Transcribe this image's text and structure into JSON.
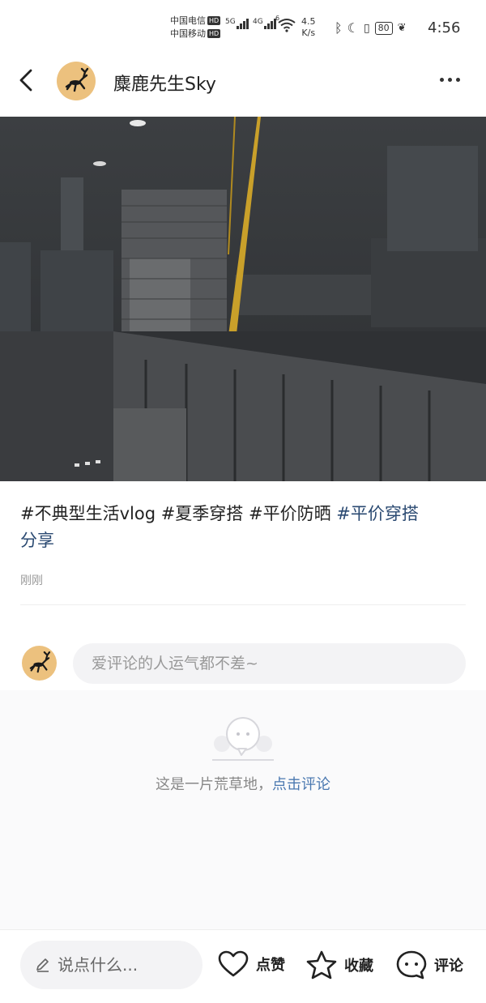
{
  "status_bar": {
    "carrier1": "中国电信",
    "carrier2": "中国移动",
    "hd": "HD",
    "net1": "5G",
    "net2": "4G",
    "wifi_sub": "6",
    "speed_value": "4.5",
    "speed_unit": "K/s",
    "battery": "80",
    "time": "4:56"
  },
  "header": {
    "username": "麋鹿先生Sky"
  },
  "post": {
    "tags_plain": "#不典型生活vlog #夏季穿搭 #平价防晒",
    "tag_link_part1": "#平价穿搭",
    "tag_link_part2": "分享",
    "time_ago": "刚刚"
  },
  "comment": {
    "placeholder": "爱评论的人运气都不差~",
    "empty_text": "这是一片荒草地，",
    "empty_link": "点击评论"
  },
  "bottom_bar": {
    "say_placeholder": "说点什么...",
    "like_label": "点赞",
    "collect_label": "收藏",
    "comment_label": "评论"
  },
  "icons": {
    "back": "chevron-left-icon",
    "more": "more-dots-icon",
    "edit": "pencil-icon",
    "like": "heart-icon",
    "collect": "star-icon",
    "comment": "speech-bubble-icon",
    "empty": "empty-chat-icon"
  },
  "colors": {
    "avatar_bg": "#ecc17e",
    "link": "#4a78b0",
    "tag_link": "#2b4a72"
  }
}
